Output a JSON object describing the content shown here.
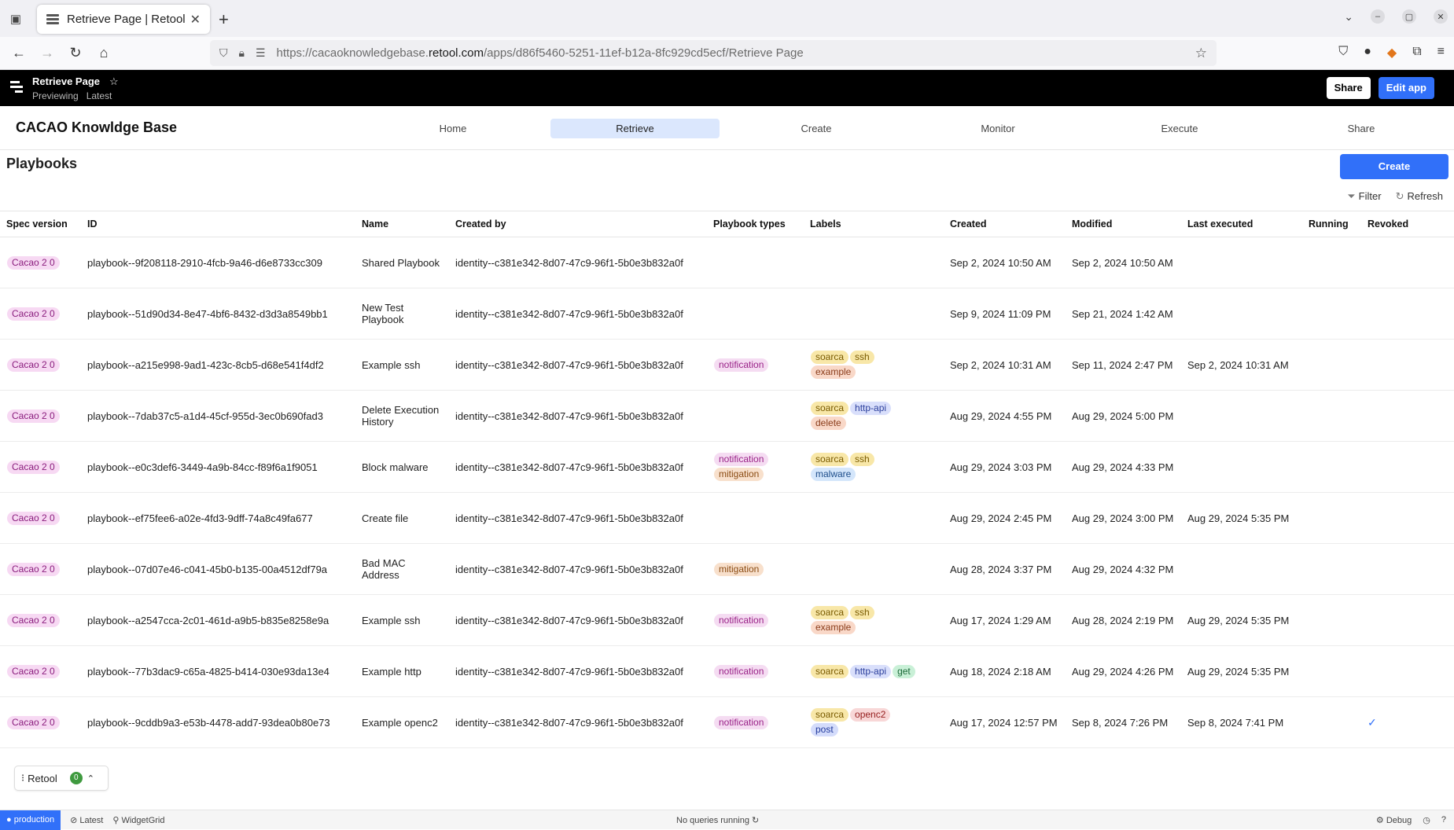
{
  "browser": {
    "tab_title": "Retrieve Page | Retool",
    "url_prefix": "https://cacaoknowledgebase.",
    "url_domain": "retool.com",
    "url_path": "/apps/d86f5460-5251-11ef-b12a-8fc929cd5ecf/Retrieve Page"
  },
  "appbar": {
    "title": "Retrieve Page",
    "mode": "Previewing",
    "version": "Latest",
    "share_label": "Share",
    "edit_label": "Edit app"
  },
  "header": {
    "brand": "CACAO Knowldge Base",
    "nav": [
      "Home",
      "Retrieve",
      "Create",
      "Monitor",
      "Execute",
      "Share"
    ],
    "active_nav": "Retrieve"
  },
  "section": {
    "title": "Playbooks",
    "create_label": "Create",
    "filter_label": "Filter",
    "refresh_label": "Refresh"
  },
  "table": {
    "columns": [
      "Spec version",
      "ID",
      "Name",
      "Created by",
      "Playbook types",
      "Labels",
      "Created",
      "Modified",
      "Last executed",
      "Running",
      "Revoked"
    ],
    "rows": [
      {
        "spec": "Cacao 2 0",
        "id": "playbook--9f208118-2910-4fcb-9a46-d6e8733cc309",
        "name": "Shared Playbook",
        "created_by": "identity--c381e342-8d07-47c9-96f1-5b0e3b832a0f",
        "types": [],
        "labels": [],
        "created": "Sep 2, 2024 10:50 AM",
        "modified": "Sep 2, 2024 10:50 AM",
        "last_executed": "",
        "running": "",
        "revoked": false
      },
      {
        "spec": "Cacao 2 0",
        "id": "playbook--51d90d34-8e47-4bf6-8432-d3d3a8549bb1",
        "name": "New Test Playbook",
        "created_by": "identity--c381e342-8d07-47c9-96f1-5b0e3b832a0f",
        "types": [],
        "labels": [],
        "created": "Sep 9, 2024 11:09 PM",
        "modified": "Sep 21, 2024 1:42 AM",
        "last_executed": "",
        "running": "",
        "revoked": false
      },
      {
        "spec": "Cacao 2 0",
        "id": "playbook--a215e998-9ad1-423c-8cb5-d68e541f4df2",
        "name": "Example ssh",
        "created_by": "identity--c381e342-8d07-47c9-96f1-5b0e3b832a0f",
        "types": [
          "notification"
        ],
        "labels": [
          "soarca",
          "ssh",
          "example"
        ],
        "created": "Sep 2, 2024 10:31 AM",
        "modified": "Sep 11, 2024 2:47 PM",
        "last_executed": "Sep 2, 2024 10:31 AM",
        "running": "",
        "revoked": false
      },
      {
        "spec": "Cacao 2 0",
        "id": "playbook--7dab37c5-a1d4-45cf-955d-3ec0b690fad3",
        "name": "Delete Execution History",
        "created_by": "identity--c381e342-8d07-47c9-96f1-5b0e3b832a0f",
        "types": [],
        "labels": [
          "soarca",
          "http-api",
          "delete"
        ],
        "created": "Aug 29, 2024 4:55 PM",
        "modified": "Aug 29, 2024 5:00 PM",
        "last_executed": "",
        "running": "",
        "revoked": false
      },
      {
        "spec": "Cacao 2 0",
        "id": "playbook--e0c3def6-3449-4a9b-84cc-f89f6a1f9051",
        "name": "Block malware",
        "created_by": "identity--c381e342-8d07-47c9-96f1-5b0e3b832a0f",
        "types": [
          "notification",
          "mitigation"
        ],
        "labels": [
          "soarca",
          "ssh",
          "malware"
        ],
        "created": "Aug 29, 2024 3:03 PM",
        "modified": "Aug 29, 2024 4:33 PM",
        "last_executed": "",
        "running": "",
        "revoked": false
      },
      {
        "spec": "Cacao 2 0",
        "id": "playbook--ef75fee6-a02e-4fd3-9dff-74a8c49fa677",
        "name": "Create file",
        "created_by": "identity--c381e342-8d07-47c9-96f1-5b0e3b832a0f",
        "types": [],
        "labels": [],
        "created": "Aug 29, 2024 2:45 PM",
        "modified": "Aug 29, 2024 3:00 PM",
        "last_executed": "Aug 29, 2024 5:35 PM",
        "running": "",
        "revoked": false
      },
      {
        "spec": "Cacao 2 0",
        "id": "playbook--07d07e46-c041-45b0-b135-00a4512df79a",
        "name": "Bad MAC Address",
        "created_by": "identity--c381e342-8d07-47c9-96f1-5b0e3b832a0f",
        "types": [
          "mitigation"
        ],
        "labels": [],
        "created": "Aug 28, 2024 3:37 PM",
        "modified": "Aug 29, 2024 4:32 PM",
        "last_executed": "",
        "running": "",
        "revoked": false
      },
      {
        "spec": "Cacao 2 0",
        "id": "playbook--a2547cca-2c01-461d-a9b5-b835e8258e9a",
        "name": "Example ssh",
        "created_by": "identity--c381e342-8d07-47c9-96f1-5b0e3b832a0f",
        "types": [
          "notification"
        ],
        "labels": [
          "soarca",
          "ssh",
          "example"
        ],
        "created": "Aug 17, 2024 1:29 AM",
        "modified": "Aug 28, 2024 2:19 PM",
        "last_executed": "Aug 29, 2024 5:35 PM",
        "running": "",
        "revoked": false
      },
      {
        "spec": "Cacao 2 0",
        "id": "playbook--77b3dac9-c65a-4825-b414-030e93da13e4",
        "name": "Example http",
        "created_by": "identity--c381e342-8d07-47c9-96f1-5b0e3b832a0f",
        "types": [
          "notification"
        ],
        "labels": [
          "soarca",
          "http-api",
          "get"
        ],
        "created": "Aug 18, 2024 2:18 AM",
        "modified": "Aug 29, 2024 4:26 PM",
        "last_executed": "Aug 29, 2024 5:35 PM",
        "running": "",
        "revoked": false
      },
      {
        "spec": "Cacao 2 0",
        "id": "playbook--9cddb9a3-e53b-4478-add7-93dea0b80e73",
        "name": "Example openc2",
        "created_by": "identity--c381e342-8d07-47c9-96f1-5b0e3b832a0f",
        "types": [
          "notification"
        ],
        "labels": [
          "soarca",
          "openc2",
          "post"
        ],
        "created": "Aug 17, 2024 12:57 PM",
        "modified": "Sep 8, 2024 7:26 PM",
        "last_executed": "Sep 8, 2024 7:41 PM",
        "running": "",
        "revoked": true
      }
    ]
  },
  "retool_badge": {
    "label": "Retool",
    "count": "0"
  },
  "statusbar": {
    "env": "production",
    "version": "Latest",
    "widget": "WidgetGrid",
    "queries": "No queries running",
    "debug": "Debug"
  }
}
